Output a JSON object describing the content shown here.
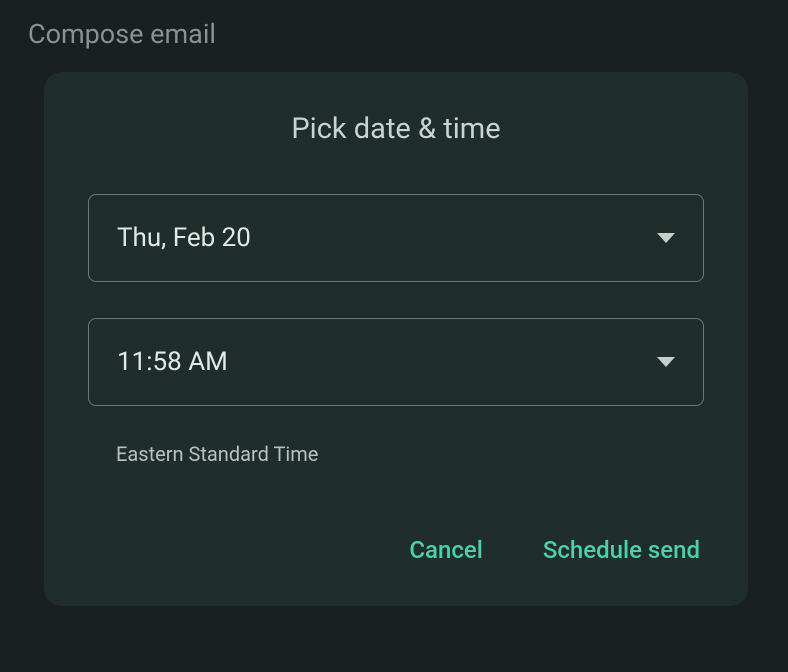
{
  "header": {
    "title": "Compose email"
  },
  "dialog": {
    "title": "Pick date & time",
    "date_field": {
      "value": "Thu, Feb 20"
    },
    "time_field": {
      "value": "11:58 AM"
    },
    "timezone_label": "Eastern Standard Time",
    "buttons": {
      "cancel": "Cancel",
      "schedule": "Schedule send"
    }
  }
}
